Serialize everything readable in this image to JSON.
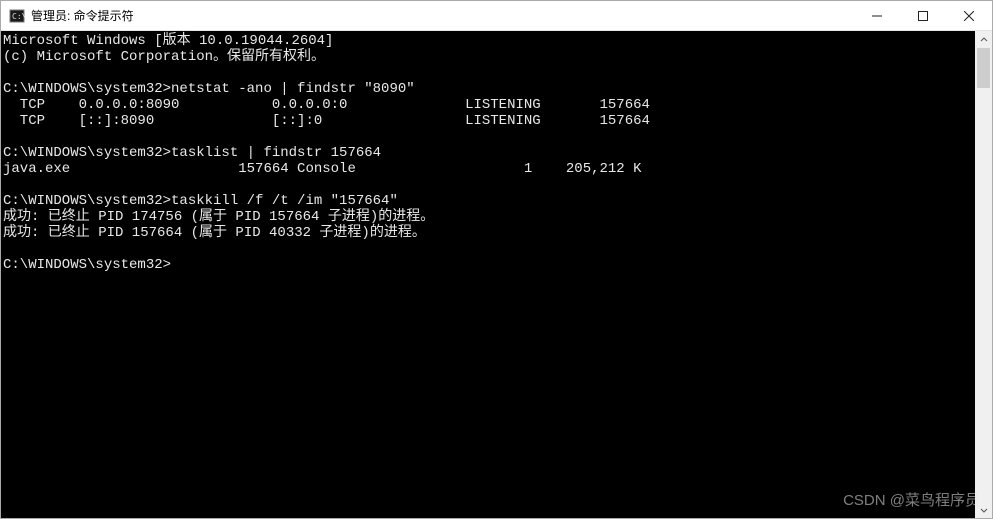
{
  "window": {
    "title": "管理员: 命令提示符"
  },
  "terminal": {
    "lines": [
      "Microsoft Windows [版本 10.0.19044.2604]",
      "(c) Microsoft Corporation。保留所有权利。",
      "",
      "C:\\WINDOWS\\system32>netstat -ano | findstr \"8090\"",
      "  TCP    0.0.0.0:8090           0.0.0.0:0              LISTENING       157664",
      "  TCP    [::]:8090              [::]:0                 LISTENING       157664",
      "",
      "C:\\WINDOWS\\system32>tasklist | findstr 157664",
      "java.exe                    157664 Console                    1    205,212 K",
      "",
      "C:\\WINDOWS\\system32>taskkill /f /t /im \"157664\"",
      "成功: 已终止 PID 174756 (属于 PID 157664 子进程)的进程。",
      "成功: 已终止 PID 157664 (属于 PID 40332 子进程)的进程。",
      "",
      "C:\\WINDOWS\\system32>"
    ]
  },
  "watermark": "CSDN @菜鸟程序员"
}
